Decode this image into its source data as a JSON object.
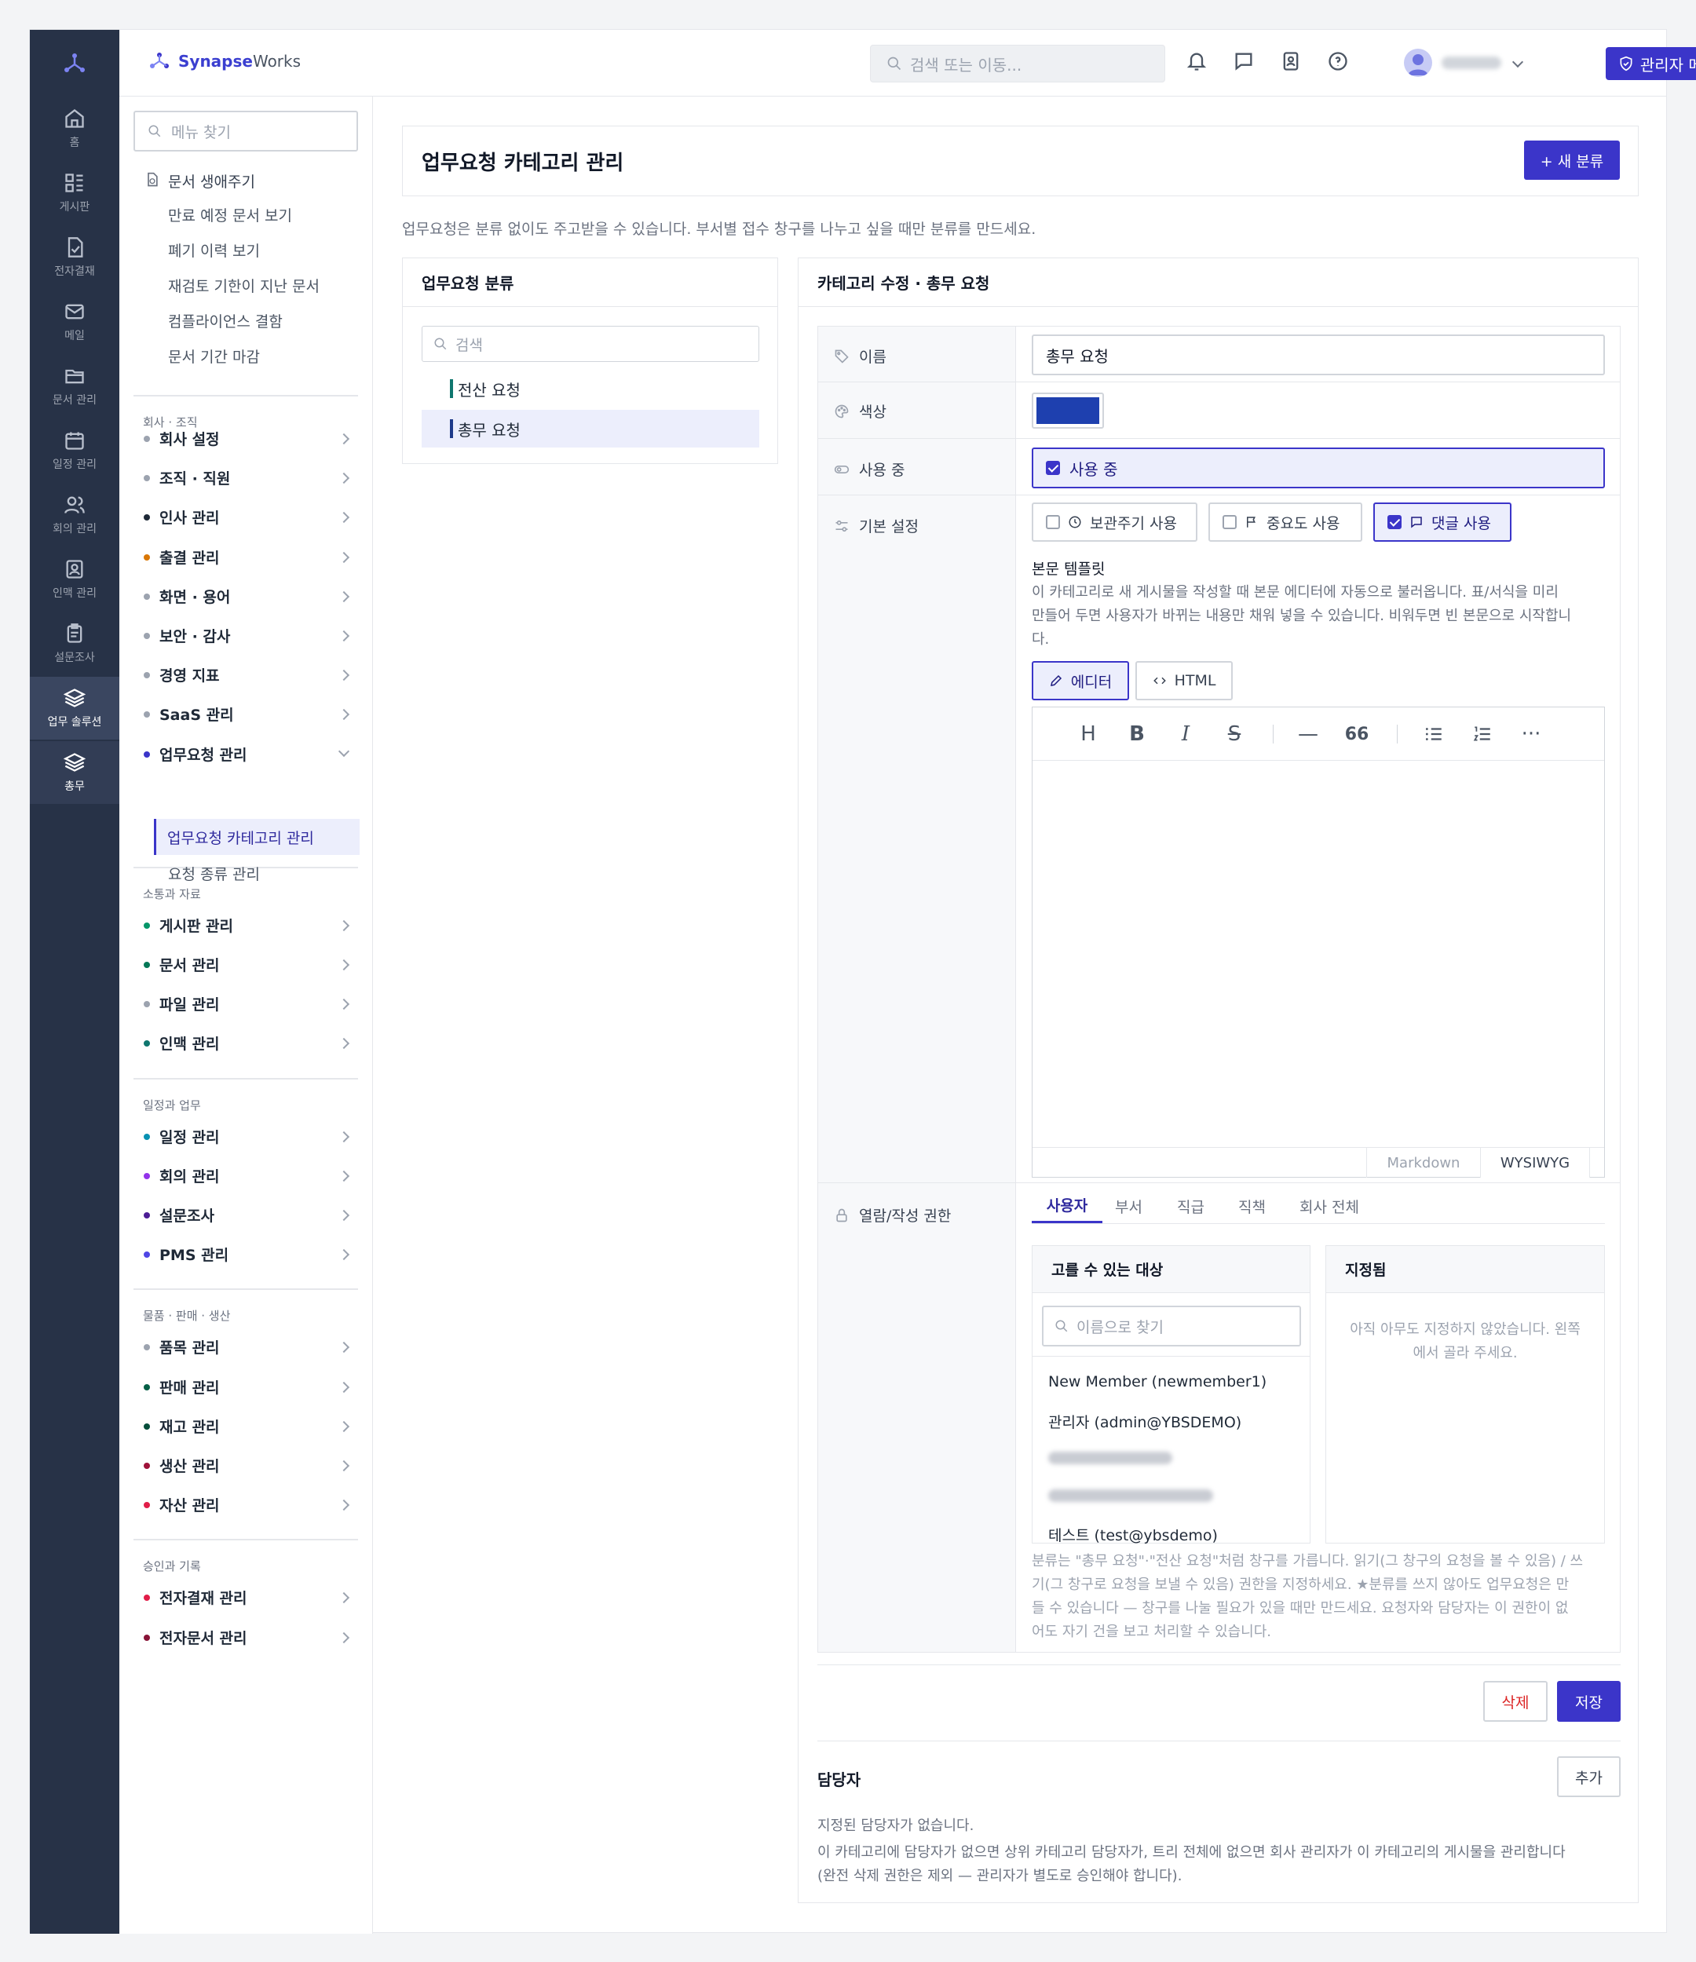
{
  "rail": {
    "items": [
      {
        "label": "홈",
        "icon": "home-icon"
      },
      {
        "label": "게시판",
        "icon": "board-icon"
      },
      {
        "label": "전자결재",
        "icon": "approval-icon"
      },
      {
        "label": "메일",
        "icon": "mail-icon"
      },
      {
        "label": "문서 관리",
        "icon": "folder-icon"
      },
      {
        "label": "일정 관리",
        "icon": "calendar-icon"
      },
      {
        "label": "회의 관리",
        "icon": "users-icon"
      },
      {
        "label": "인맥 관리",
        "icon": "contact-icon"
      },
      {
        "label": "설문조사",
        "icon": "survey-icon"
      },
      {
        "label": "업무 솔루션",
        "icon": "layers-icon"
      },
      {
        "label": "총무",
        "icon": "layers-icon"
      }
    ]
  },
  "header": {
    "brand_bold": "Synapse",
    "brand_rest": "Works",
    "search_placeholder": "검색 또는 이동...",
    "admin_label": "관리자 메뉴"
  },
  "sidebar": {
    "search_placeholder": "메뉴 찾기",
    "lifecycle": {
      "title": "문서 생애주기",
      "items": [
        "만료 예정 문서 보기",
        "폐기 이력 보기",
        "재검토 기한이 지난 문서",
        "컴플라이언스 결함",
        "문서 기간 마감"
      ]
    },
    "groups": [
      {
        "title": "회사 · 조직",
        "items": [
          {
            "label": "회사 설정",
            "color": "#9ca3af"
          },
          {
            "label": "조직 · 직원",
            "color": "#9ca3af"
          },
          {
            "label": "인사 관리",
            "color": "#1f2937"
          },
          {
            "label": "출결 관리",
            "color": "#d97706"
          },
          {
            "label": "화면 · 용어",
            "color": "#9ca3af"
          },
          {
            "label": "보안 · 감사",
            "color": "#9ca3af"
          },
          {
            "label": "경영 지표",
            "color": "#9ca3af"
          },
          {
            "label": "SaaS 관리",
            "color": "#9ca3af"
          },
          {
            "label": "업무요청 관리",
            "color": "#3b35c9"
          }
        ]
      },
      {
        "title": "소통과 자료",
        "items": [
          {
            "label": "게시판 관리",
            "color": "#059669"
          },
          {
            "label": "문서 관리",
            "color": "#047857"
          },
          {
            "label": "파일 관리",
            "color": "#9ca3af"
          },
          {
            "label": "인맥 관리",
            "color": "#0f766e"
          }
        ]
      },
      {
        "title": "일정과 업무",
        "items": [
          {
            "label": "일정 관리",
            "color": "#0891b2"
          },
          {
            "label": "회의 관리",
            "color": "#9333ea"
          },
          {
            "label": "설문조사",
            "color": "#4c1d95"
          },
          {
            "label": "PMS 관리",
            "color": "#4f46e5"
          }
        ]
      },
      {
        "title": "물품 · 판매 · 생산",
        "items": [
          {
            "label": "품목 관리",
            "color": "#9ca3af"
          },
          {
            "label": "판매 관리",
            "color": "#065f46"
          },
          {
            "label": "재고 관리",
            "color": "#064e3b"
          },
          {
            "label": "생산 관리",
            "color": "#9f1239"
          },
          {
            "label": "자산 관리",
            "color": "#e11d48"
          }
        ]
      },
      {
        "title": "승인과 기록",
        "items": [
          {
            "label": "전자결재 관리",
            "color": "#e11d48"
          },
          {
            "label": "전자문서 관리",
            "color": "#881337"
          }
        ]
      }
    ],
    "sub_active": "업무요청 카테고리 관리",
    "sub_other": "요청 종류 관리"
  },
  "page": {
    "title": "업무요청 카테고리 관리",
    "new_button": "+ 새 분류",
    "description": "업무요청은 분류 없이도 주고받을 수 있습니다. 부서별 접수 창구를 나누고 싶을 때만 분류를 만드세요."
  },
  "categories": {
    "title": "업무요청 분류",
    "search_placeholder": "검색",
    "items": [
      {
        "label": "전산 요청",
        "color": "#0f766e"
      },
      {
        "label": "총무 요청",
        "color": "#1e3a8a"
      }
    ]
  },
  "edit": {
    "title": "카테고리 수정 · 총무 요청",
    "name_label": "이름",
    "name_value": "총무 요청",
    "color_label": "색상",
    "color_value": "#1e40af",
    "inuse_label": "사용 중",
    "inuse_check": "사용 중",
    "basic_label": "기본 설정",
    "options": [
      "보관주기 사용",
      "중요도 사용",
      "댓글 사용"
    ],
    "template_title": "본문 템플릿",
    "template_desc_1": "이 카테고리로 새 게시물을 작성할 때 본문 에디터에 자동으로 불러옵니다. 표/서식을 미리",
    "template_desc_2": "만들어 두면 사용자가 바뀌는 내용만 채워 넣을 수 있습니다. 비워두면 빈 본문으로 시작합니",
    "template_desc_3": "다.",
    "editor_tab": "에디터",
    "html_tab": "HTML",
    "mode_markdown": "Markdown",
    "mode_wysiwyg": "WYSIWYG",
    "perm_label": "열람/작성 권한",
    "perm_tabs": [
      "사용자",
      "부서",
      "직급",
      "직책",
      "회사 전체"
    ],
    "available_title": "고를 수 있는 대상",
    "available_search": "이름으로 찾기",
    "members": [
      "New Member (newmember1)",
      "관리자 (admin@YBSDEMO)",
      "테스트 (test@ybsdemo)"
    ],
    "assigned_title": "지정됨",
    "assigned_empty_1": "아직 아무도 지정하지 않았습니다. 왼쪽",
    "assigned_empty_2": "에서 골라 주세요.",
    "help_1": "분류는 \"총무 요청\"·\"전산 요청\"처럼 창구를 가릅니다. 읽기(그 창구의 요청을 볼 수 있음) / 쓰",
    "help_2": "기(그 창구로 요청을 보낼 수 있음) 권한을 지정하세요. ★분류를 쓰지 않아도 업무요청은 만",
    "help_3": "들 수 있습니다 — 창구를 나눌 필요가 있을 때만 만드세요. 요청자와 담당자는 이 권한이 없",
    "help_4": "어도 자기 건을 보고 처리할 수 있습니다.",
    "delete_button": "삭제",
    "save_button": "저장",
    "manager_title": "담당자",
    "add_button": "추가",
    "manager_empty": "지정된 담당자가 없습니다.",
    "manager_desc_1": "이 카테고리에 담당자가 없으면 상위 카테고리 담당자가, 트리 전체에 없으면 회사 관리자가 이 카테고리의 게시물을 관리합니다",
    "manager_desc_2": "(완전 삭제 권한은 제외 — 관리자가 별도로 승인해야 합니다)."
  }
}
